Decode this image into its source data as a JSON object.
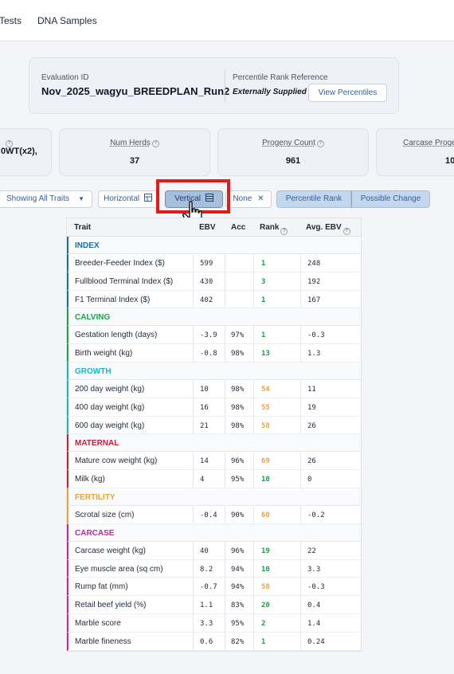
{
  "nav": {
    "tabs": [
      "Tests",
      "DNA Samples"
    ]
  },
  "evaluation": {
    "id_label": "Evaluation ID",
    "id_value": "Nov_2025_wagyu_BREEDPLAN_Run2",
    "percentile_label": "Percentile Rank Reference",
    "percentile_value": "Externally Supplied",
    "view_percentiles_label": "View Percentiles"
  },
  "stats": [
    {
      "label": "",
      "value": "0WT(x2),"
    },
    {
      "label": "Num Herds",
      "value": "37"
    },
    {
      "label": "Progeny Count",
      "value": "961"
    },
    {
      "label": "Carcase Proge",
      "value": "10"
    }
  ],
  "toolbar": {
    "showing_label": "Showing All Traits",
    "horizontal_label": "Horizontal",
    "vertical_label": "Vertical",
    "none_label": "None",
    "percentile_rank_label": "Percentile Rank",
    "possible_change_label": "Possible Change"
  },
  "table": {
    "headers": {
      "trait": "Trait",
      "ebv": "EBV",
      "acc": "Acc",
      "rank": "Rank",
      "avg": "Avg. EBV"
    },
    "categories": [
      {
        "name": "INDEX",
        "color": "#1a6fa0",
        "rows": [
          {
            "trait": "Breeder-Feeder Index ($)",
            "ebv": "599",
            "acc": "",
            "rank": "1",
            "rank_color": "#16a34a",
            "avg": "248"
          },
          {
            "trait": "Fullblood Terminal Index ($)",
            "ebv": "430",
            "acc": "",
            "rank": "3",
            "rank_color": "#16a34a",
            "avg": "192"
          },
          {
            "trait": "F1 Terminal Index ($)",
            "ebv": "402",
            "acc": "",
            "rank": "1",
            "rank_color": "#16a34a",
            "avg": "167"
          }
        ]
      },
      {
        "name": "CALVING",
        "color": "#16a34a",
        "rows": [
          {
            "trait": "Gestation length (days)",
            "ebv": "-3.9",
            "acc": "97%",
            "rank": "1",
            "rank_color": "#16a34a",
            "avg": "-0.3"
          },
          {
            "trait": "Birth weight (kg)",
            "ebv": "-0.8",
            "acc": "98%",
            "rank": "13",
            "rank_color": "#16a34a",
            "avg": "1.3"
          }
        ]
      },
      {
        "name": "GROWTH",
        "color": "#17b6c4",
        "rows": [
          {
            "trait": "200 day weight (kg)",
            "ebv": "10",
            "acc": "98%",
            "rank": "54",
            "rank_color": "#e8a33a",
            "avg": "11"
          },
          {
            "trait": "400 day weight (kg)",
            "ebv": "16",
            "acc": "98%",
            "rank": "55",
            "rank_color": "#e8a33a",
            "avg": "19"
          },
          {
            "trait": "600 day weight (kg)",
            "ebv": "21",
            "acc": "98%",
            "rank": "58",
            "rank_color": "#e8a33a",
            "avg": "26"
          }
        ]
      },
      {
        "name": "MATERNAL",
        "color": "#c81e3a",
        "rows": [
          {
            "trait": "Mature cow weight (kg)",
            "ebv": "14",
            "acc": "96%",
            "rank": "69",
            "rank_color": "#e8a33a",
            "avg": "26"
          },
          {
            "trait": "Milk (kg)",
            "ebv": "4",
            "acc": "95%",
            "rank": "10",
            "rank_color": "#16a34a",
            "avg": "0"
          }
        ]
      },
      {
        "name": "FERTILITY",
        "color": "#e8a33a",
        "rows": [
          {
            "trait": "Scrotal size (cm)",
            "ebv": "-0.4",
            "acc": "90%",
            "rank": "60",
            "rank_color": "#e8a33a",
            "avg": "-0.2"
          }
        ]
      },
      {
        "name": "CARCASE",
        "color": "#c026a4",
        "rows": [
          {
            "trait": "Carcase weight (kg)",
            "ebv": "40",
            "acc": "96%",
            "rank": "19",
            "rank_color": "#16a34a",
            "avg": "22"
          },
          {
            "trait": "Eye muscle area (sq cm)",
            "ebv": "8.2",
            "acc": "94%",
            "rank": "10",
            "rank_color": "#16a34a",
            "avg": "3.3"
          },
          {
            "trait": "Rump fat (mm)",
            "ebv": "-0.7",
            "acc": "94%",
            "rank": "58",
            "rank_color": "#e8a33a",
            "avg": "-0.3"
          },
          {
            "trait": "Retail beef yield (%)",
            "ebv": "1.1",
            "acc": "83%",
            "rank": "20",
            "rank_color": "#16a34a",
            "avg": "0.4"
          },
          {
            "trait": "Marble score",
            "ebv": "3.3",
            "acc": "95%",
            "rank": "2",
            "rank_color": "#16a34a",
            "avg": "1.4"
          },
          {
            "trait": "Marble fineness",
            "ebv": "0.6",
            "acc": "82%",
            "rank": "1",
            "rank_color": "#16a34a",
            "avg": "0.24"
          }
        ]
      }
    ]
  }
}
